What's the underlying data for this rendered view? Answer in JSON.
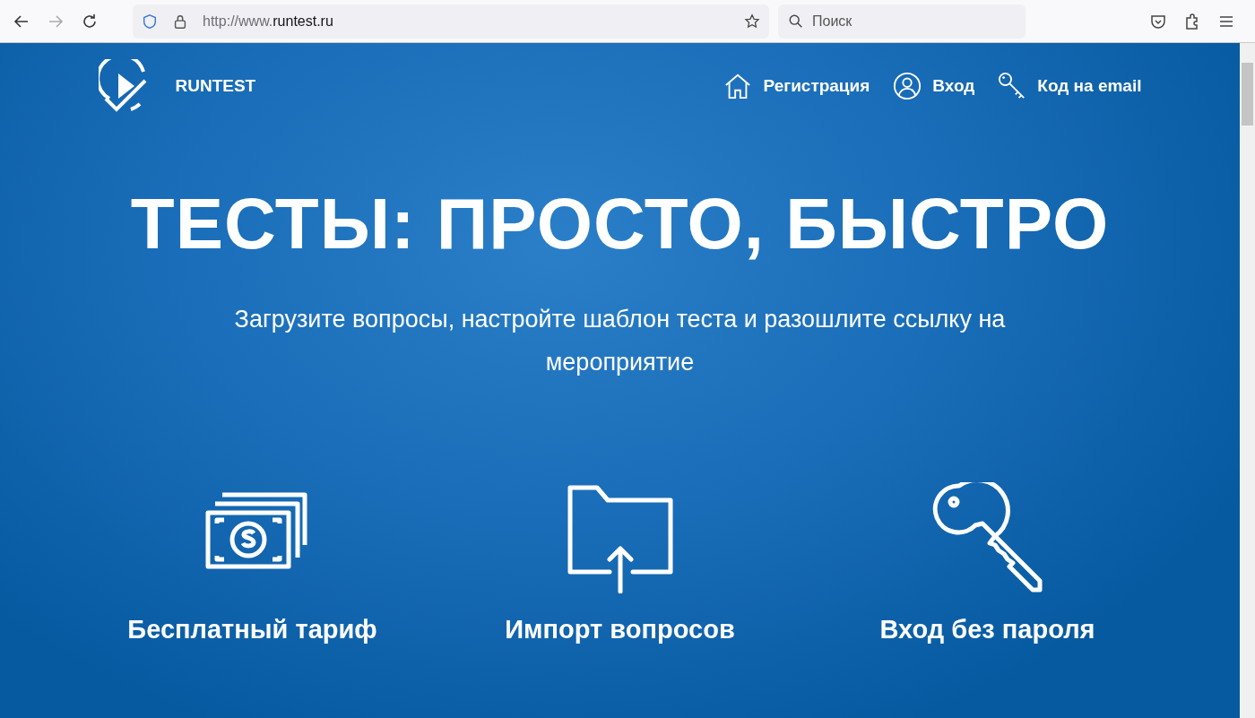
{
  "browser": {
    "url_prefix": "http://www.",
    "url_domain": "runtest.ru",
    "search_placeholder": "Поиск"
  },
  "site": {
    "logo_text": "RUNTEST",
    "nav": [
      {
        "label": "Регистрация"
      },
      {
        "label": "Вход"
      },
      {
        "label": "Код на email"
      }
    ],
    "headline": "ТЕСТЫ: ПРОСТО, БЫСТРО",
    "subtitle": "Загрузите вопросы, настройте шаблон теста и разошлите ссылку на мероприятие",
    "features": [
      {
        "label": "Бесплатный тариф"
      },
      {
        "label": "Импорт вопросов"
      },
      {
        "label": "Вход без пароля"
      }
    ]
  }
}
